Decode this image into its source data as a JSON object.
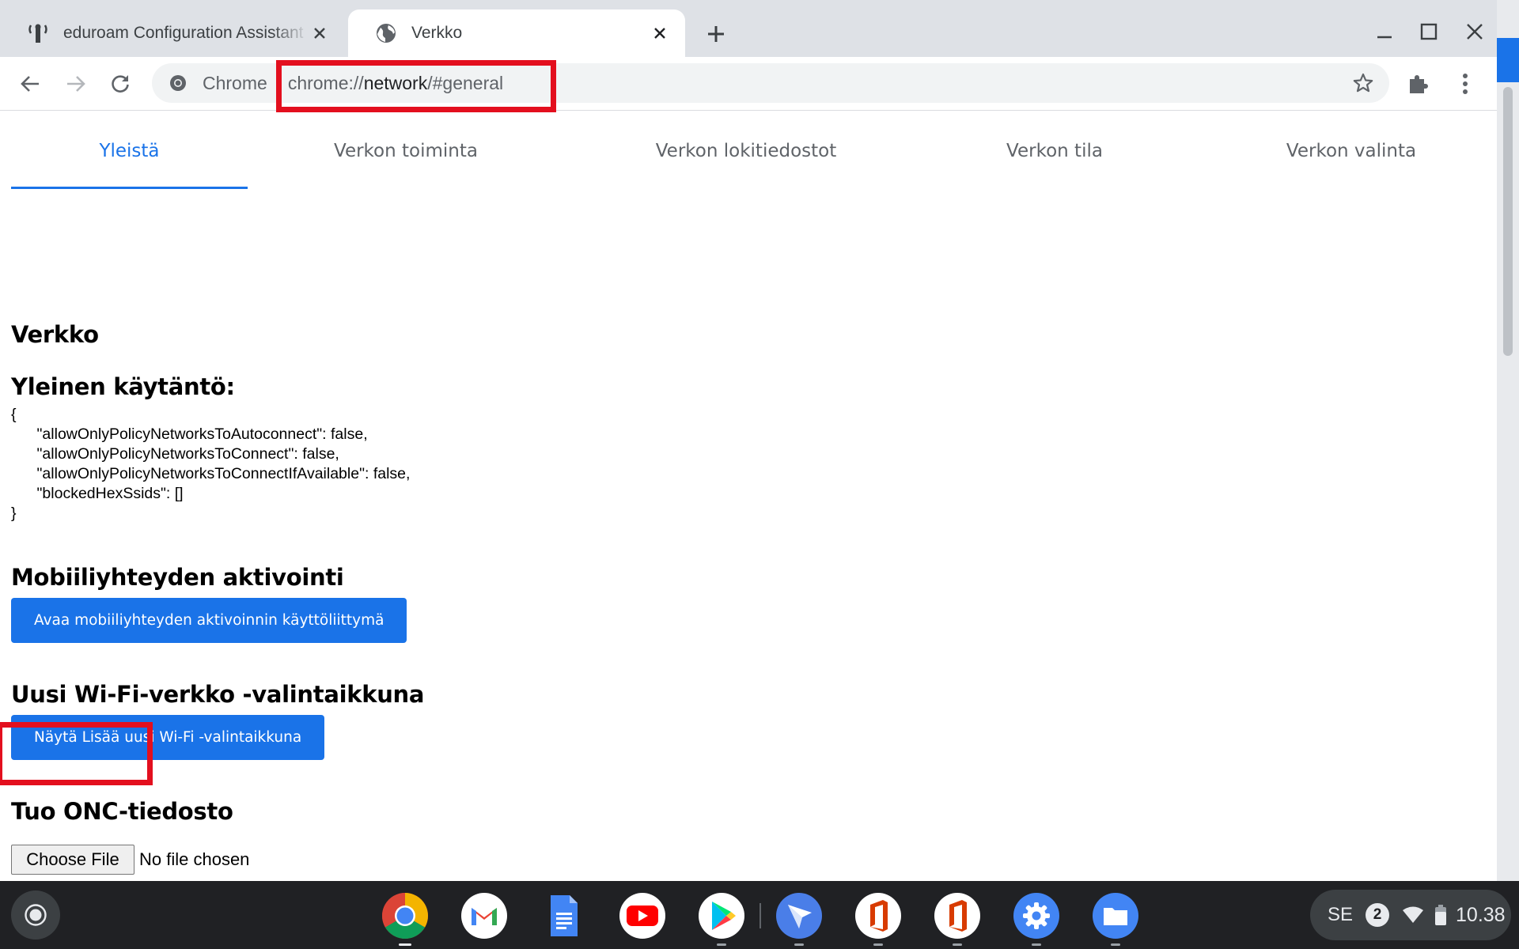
{
  "browser": {
    "tabs": [
      {
        "title": "eduroam Configuration Assistant Tool",
        "active": false
      },
      {
        "title": "Verkko",
        "active": true
      }
    ],
    "omnibox": {
      "chip": "Chrome",
      "url_scheme": "chrome://",
      "url_host": "network",
      "url_rest": "/#general"
    }
  },
  "page": {
    "tabs": [
      "Yleistä",
      "Verkon toiminta",
      "Verkon lokitiedostot",
      "Verkon tila",
      "Verkon valinta"
    ],
    "selected_tab": "Yleistä",
    "title": "Verkko",
    "policy_heading": "Yleinen käytäntö:",
    "policy_json": "{\n      \"allowOnlyPolicyNetworksToAutoconnect\": false,\n      \"allowOnlyPolicyNetworksToConnect\": false,\n      \"allowOnlyPolicyNetworksToConnectIfAvailable\": false,\n      \"blockedHexSsids\": []\n}",
    "cellular_heading": "Mobiiliyhteyden aktivointi",
    "cellular_button": "Avaa mobiiliyhteyden aktivoinnin käyttöliittymä",
    "wifi_heading": "Uusi Wi-Fi-verkko -valintaikkuna",
    "wifi_button": "Näytä Lisää uusi Wi-Fi -valintaikkuna",
    "onc_heading": "Tuo ONC-tiedosto",
    "file_button": "Choose File",
    "file_status": "No file chosen"
  },
  "shelf": {
    "apps": [
      "chrome-icon",
      "gmail-icon",
      "docs-icon",
      "youtube-icon",
      "play-store-icon",
      "rocket-app-icon",
      "office-icon",
      "office-icon",
      "settings-icon",
      "files-icon"
    ],
    "tray": {
      "language": "SE",
      "notifications": "2",
      "time": "10.38"
    }
  },
  "colors": {
    "accent": "#1a73e8",
    "highlight": "#e30f1e",
    "shelf": "#202124"
  }
}
